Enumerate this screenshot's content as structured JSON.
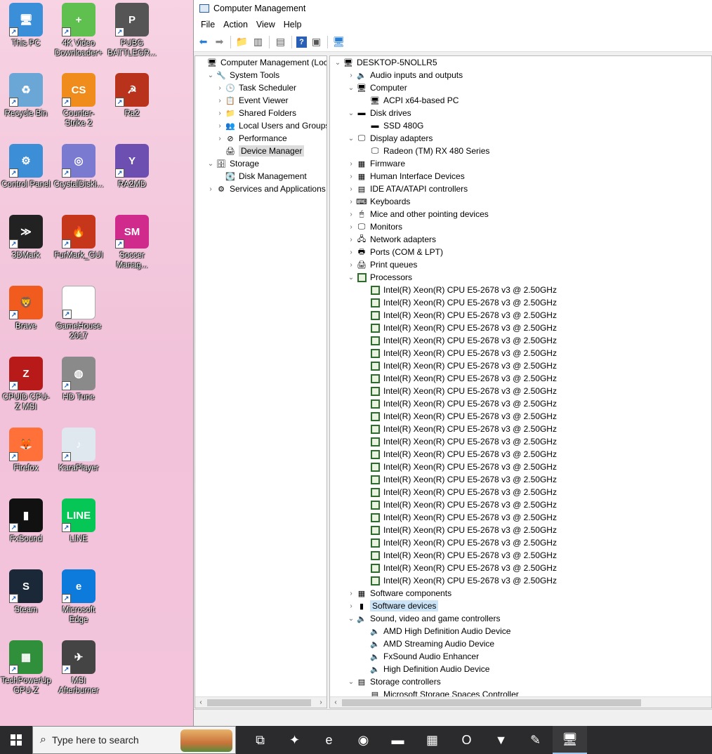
{
  "desktop": {
    "icons": [
      {
        "label": "This PC",
        "glyph": "🖥",
        "bg": "#3a8fd8",
        "col": 0,
        "row": 0
      },
      {
        "label": "4K Video Downloader+",
        "glyph": "+",
        "bg": "#5fbf4f",
        "col": 1,
        "row": 0
      },
      {
        "label": "PUBG BATTLEGR...",
        "glyph": "P",
        "bg": "#555",
        "col": 2,
        "row": 0
      },
      {
        "label": "Recycle Bin",
        "glyph": "♻",
        "bg": "#6aa7d6",
        "col": 0,
        "row": 1
      },
      {
        "label": "Counter-Strike 2",
        "glyph": "CS",
        "bg": "#f08c1c",
        "col": 1,
        "row": 1
      },
      {
        "label": "Ra2",
        "glyph": "☭",
        "bg": "#b8321c",
        "col": 2,
        "row": 1
      },
      {
        "label": "Control Panel",
        "glyph": "⚙",
        "bg": "#3c8ed6",
        "col": 0,
        "row": 2
      },
      {
        "label": "CrystalDiskI...",
        "glyph": "◎",
        "bg": "#7a7ad0",
        "col": 1,
        "row": 2
      },
      {
        "label": "RA2MD",
        "glyph": "Y",
        "bg": "#6c4fb0",
        "col": 2,
        "row": 2
      },
      {
        "label": "3DMark",
        "glyph": "≫",
        "bg": "#222",
        "col": 0,
        "row": 3
      },
      {
        "label": "FurMark_GUI",
        "glyph": "🔥",
        "bg": "#c6361a",
        "col": 1,
        "row": 3
      },
      {
        "label": "Soccer Manag...",
        "glyph": "SM",
        "bg": "#d02a8c",
        "col": 2,
        "row": 3
      },
      {
        "label": "Brave",
        "glyph": "🦁",
        "bg": "#f25b1e",
        "col": 0,
        "row": 4
      },
      {
        "label": "GameHouse 2017",
        "glyph": "",
        "bg": "#ffffff",
        "col": 1,
        "row": 4
      },
      {
        "label": "CPUID CPU-Z MSI",
        "glyph": "Z",
        "bg": "#b81a1a",
        "col": 0,
        "row": 5
      },
      {
        "label": "HD Tune",
        "glyph": "◍",
        "bg": "#8a8a8a",
        "col": 1,
        "row": 5
      },
      {
        "label": "Firefox",
        "glyph": "🦊",
        "bg": "#ff7139",
        "col": 0,
        "row": 6
      },
      {
        "label": "KaraPlayer",
        "glyph": "♪",
        "bg": "#dfe7ef",
        "col": 1,
        "row": 6
      },
      {
        "label": "FxSound",
        "glyph": "▮",
        "bg": "#111",
        "col": 0,
        "row": 7
      },
      {
        "label": "LINE",
        "glyph": "LINE",
        "bg": "#06c755",
        "col": 1,
        "row": 7
      },
      {
        "label": "Steam",
        "glyph": "S",
        "bg": "#1b2838",
        "col": 0,
        "row": 8
      },
      {
        "label": "Microsoft Edge",
        "glyph": "e",
        "bg": "#0c7bdc",
        "col": 1,
        "row": 8
      },
      {
        "label": "TechPowerUp GPU-Z",
        "glyph": "▦",
        "bg": "#2f8f3a",
        "col": 0,
        "row": 9
      },
      {
        "label": "MSI Afterburner",
        "glyph": "✈",
        "bg": "#444",
        "col": 1,
        "row": 9
      }
    ]
  },
  "window": {
    "title": "Computer Management",
    "menu": [
      "File",
      "Action",
      "View",
      "Help"
    ]
  },
  "left_tree": [
    {
      "label": "Computer Management (Local",
      "level": 0,
      "exp": "",
      "icon": "🖥"
    },
    {
      "label": "System Tools",
      "level": 1,
      "exp": "⌄",
      "icon": "🔧"
    },
    {
      "label": "Task Scheduler",
      "level": 2,
      "exp": "›",
      "icon": "🕒"
    },
    {
      "label": "Event Viewer",
      "level": 2,
      "exp": "›",
      "icon": "📋"
    },
    {
      "label": "Shared Folders",
      "level": 2,
      "exp": "›",
      "icon": "📁"
    },
    {
      "label": "Local Users and Groups",
      "level": 2,
      "exp": "›",
      "icon": "👥"
    },
    {
      "label": "Performance",
      "level": 2,
      "exp": "›",
      "icon": "⊘"
    },
    {
      "label": "Device Manager",
      "level": 2,
      "exp": "",
      "icon": "🖨",
      "selected": true
    },
    {
      "label": "Storage",
      "level": 1,
      "exp": "⌄",
      "icon": "🗄"
    },
    {
      "label": "Disk Management",
      "level": 2,
      "exp": "",
      "icon": "💽"
    },
    {
      "label": "Services and Applications",
      "level": 1,
      "exp": "›",
      "icon": "⚙"
    }
  ],
  "device_tree": [
    {
      "label": "DESKTOP-5NOLLR5",
      "level": 0,
      "exp": "⌄",
      "icon": "🖥"
    },
    {
      "label": "Audio inputs and outputs",
      "level": 1,
      "exp": "›",
      "icon": "🔈"
    },
    {
      "label": "Computer",
      "level": 1,
      "exp": "⌄",
      "icon": "🖥"
    },
    {
      "label": "ACPI x64-based PC",
      "level": 2,
      "exp": "",
      "icon": "🖥"
    },
    {
      "label": "Disk drives",
      "level": 1,
      "exp": "⌄",
      "icon": "▬"
    },
    {
      "label": "SSD 480G",
      "level": 2,
      "exp": "",
      "icon": "▬"
    },
    {
      "label": "Display adapters",
      "level": 1,
      "exp": "⌄",
      "icon": "🖵"
    },
    {
      "label": "Radeon (TM) RX 480 Series",
      "level": 2,
      "exp": "",
      "icon": "🖵"
    },
    {
      "label": "Firmware",
      "level": 1,
      "exp": "›",
      "icon": "▦"
    },
    {
      "label": "Human Interface Devices",
      "level": 1,
      "exp": "›",
      "icon": "▦"
    },
    {
      "label": "IDE ATA/ATAPI controllers",
      "level": 1,
      "exp": "›",
      "icon": "▤"
    },
    {
      "label": "Keyboards",
      "level": 1,
      "exp": "›",
      "icon": "⌨"
    },
    {
      "label": "Mice and other pointing devices",
      "level": 1,
      "exp": "›",
      "icon": "🖱"
    },
    {
      "label": "Monitors",
      "level": 1,
      "exp": "›",
      "icon": "🖵"
    },
    {
      "label": "Network adapters",
      "level": 1,
      "exp": "›",
      "icon": "🖧"
    },
    {
      "label": "Ports (COM & LPT)",
      "level": 1,
      "exp": "›",
      "icon": "🖶"
    },
    {
      "label": "Print queues",
      "level": 1,
      "exp": "›",
      "icon": "🖨"
    },
    {
      "label": "Processors",
      "level": 1,
      "exp": "⌄",
      "icon": "cpu"
    },
    {
      "label": "Intel(R) Xeon(R) CPU E5-2678 v3 @ 2.50GHz",
      "level": 2,
      "exp": "",
      "icon": "cpu"
    },
    {
      "label": "Intel(R) Xeon(R) CPU E5-2678 v3 @ 2.50GHz",
      "level": 2,
      "exp": "",
      "icon": "cpu"
    },
    {
      "label": "Intel(R) Xeon(R) CPU E5-2678 v3 @ 2.50GHz",
      "level": 2,
      "exp": "",
      "icon": "cpu"
    },
    {
      "label": "Intel(R) Xeon(R) CPU E5-2678 v3 @ 2.50GHz",
      "level": 2,
      "exp": "",
      "icon": "cpu"
    },
    {
      "label": "Intel(R) Xeon(R) CPU E5-2678 v3 @ 2.50GHz",
      "level": 2,
      "exp": "",
      "icon": "cpu"
    },
    {
      "label": "Intel(R) Xeon(R) CPU E5-2678 v3 @ 2.50GHz",
      "level": 2,
      "exp": "",
      "icon": "cpu"
    },
    {
      "label": "Intel(R) Xeon(R) CPU E5-2678 v3 @ 2.50GHz",
      "level": 2,
      "exp": "",
      "icon": "cpu"
    },
    {
      "label": "Intel(R) Xeon(R) CPU E5-2678 v3 @ 2.50GHz",
      "level": 2,
      "exp": "",
      "icon": "cpu"
    },
    {
      "label": "Intel(R) Xeon(R) CPU E5-2678 v3 @ 2.50GHz",
      "level": 2,
      "exp": "",
      "icon": "cpu"
    },
    {
      "label": "Intel(R) Xeon(R) CPU E5-2678 v3 @ 2.50GHz",
      "level": 2,
      "exp": "",
      "icon": "cpu"
    },
    {
      "label": "Intel(R) Xeon(R) CPU E5-2678 v3 @ 2.50GHz",
      "level": 2,
      "exp": "",
      "icon": "cpu"
    },
    {
      "label": "Intel(R) Xeon(R) CPU E5-2678 v3 @ 2.50GHz",
      "level": 2,
      "exp": "",
      "icon": "cpu"
    },
    {
      "label": "Intel(R) Xeon(R) CPU E5-2678 v3 @ 2.50GHz",
      "level": 2,
      "exp": "",
      "icon": "cpu"
    },
    {
      "label": "Intel(R) Xeon(R) CPU E5-2678 v3 @ 2.50GHz",
      "level": 2,
      "exp": "",
      "icon": "cpu"
    },
    {
      "label": "Intel(R) Xeon(R) CPU E5-2678 v3 @ 2.50GHz",
      "level": 2,
      "exp": "",
      "icon": "cpu"
    },
    {
      "label": "Intel(R) Xeon(R) CPU E5-2678 v3 @ 2.50GHz",
      "level": 2,
      "exp": "",
      "icon": "cpu"
    },
    {
      "label": "Intel(R) Xeon(R) CPU E5-2678 v3 @ 2.50GHz",
      "level": 2,
      "exp": "",
      "icon": "cpu"
    },
    {
      "label": "Intel(R) Xeon(R) CPU E5-2678 v3 @ 2.50GHz",
      "level": 2,
      "exp": "",
      "icon": "cpu"
    },
    {
      "label": "Intel(R) Xeon(R) CPU E5-2678 v3 @ 2.50GHz",
      "level": 2,
      "exp": "",
      "icon": "cpu"
    },
    {
      "label": "Intel(R) Xeon(R) CPU E5-2678 v3 @ 2.50GHz",
      "level": 2,
      "exp": "",
      "icon": "cpu"
    },
    {
      "label": "Intel(R) Xeon(R) CPU E5-2678 v3 @ 2.50GHz",
      "level": 2,
      "exp": "",
      "icon": "cpu"
    },
    {
      "label": "Intel(R) Xeon(R) CPU E5-2678 v3 @ 2.50GHz",
      "level": 2,
      "exp": "",
      "icon": "cpu"
    },
    {
      "label": "Intel(R) Xeon(R) CPU E5-2678 v3 @ 2.50GHz",
      "level": 2,
      "exp": "",
      "icon": "cpu"
    },
    {
      "label": "Intel(R) Xeon(R) CPU E5-2678 v3 @ 2.50GHz",
      "level": 2,
      "exp": "",
      "icon": "cpu"
    },
    {
      "label": "Software components",
      "level": 1,
      "exp": "›",
      "icon": "▦"
    },
    {
      "label": "Software devices",
      "level": 1,
      "exp": "›",
      "icon": "▮",
      "selected": true
    },
    {
      "label": "Sound, video and game controllers",
      "level": 1,
      "exp": "⌄",
      "icon": "🔈"
    },
    {
      "label": "AMD High Definition Audio Device",
      "level": 2,
      "exp": "",
      "icon": "🔈"
    },
    {
      "label": "AMD Streaming Audio Device",
      "level": 2,
      "exp": "",
      "icon": "🔈"
    },
    {
      "label": "FxSound Audio Enhancer",
      "level": 2,
      "exp": "",
      "icon": "🔈"
    },
    {
      "label": "High Definition Audio Device",
      "level": 2,
      "exp": "",
      "icon": "🔈"
    },
    {
      "label": "Storage controllers",
      "level": 1,
      "exp": "⌄",
      "icon": "▤"
    },
    {
      "label": "Microsoft Storage Spaces Controller",
      "level": 2,
      "exp": "",
      "icon": "▤"
    }
  ],
  "taskbar": {
    "search_placeholder": "Type here to search",
    "apps": [
      {
        "name": "task-view-icon",
        "glyph": "⧉"
      },
      {
        "name": "copilot-icon",
        "glyph": "✦"
      },
      {
        "name": "edge-icon",
        "glyph": "e"
      },
      {
        "name": "firefox-icon",
        "glyph": "◉"
      },
      {
        "name": "file-explorer-icon",
        "glyph": "▬"
      },
      {
        "name": "store-icon",
        "glyph": "▦"
      },
      {
        "name": "outlook-icon",
        "glyph": "O"
      },
      {
        "name": "brave-icon",
        "glyph": "▼"
      },
      {
        "name": "paint-icon",
        "glyph": "✎"
      },
      {
        "name": "computer-management-icon",
        "glyph": "🖥"
      }
    ]
  }
}
